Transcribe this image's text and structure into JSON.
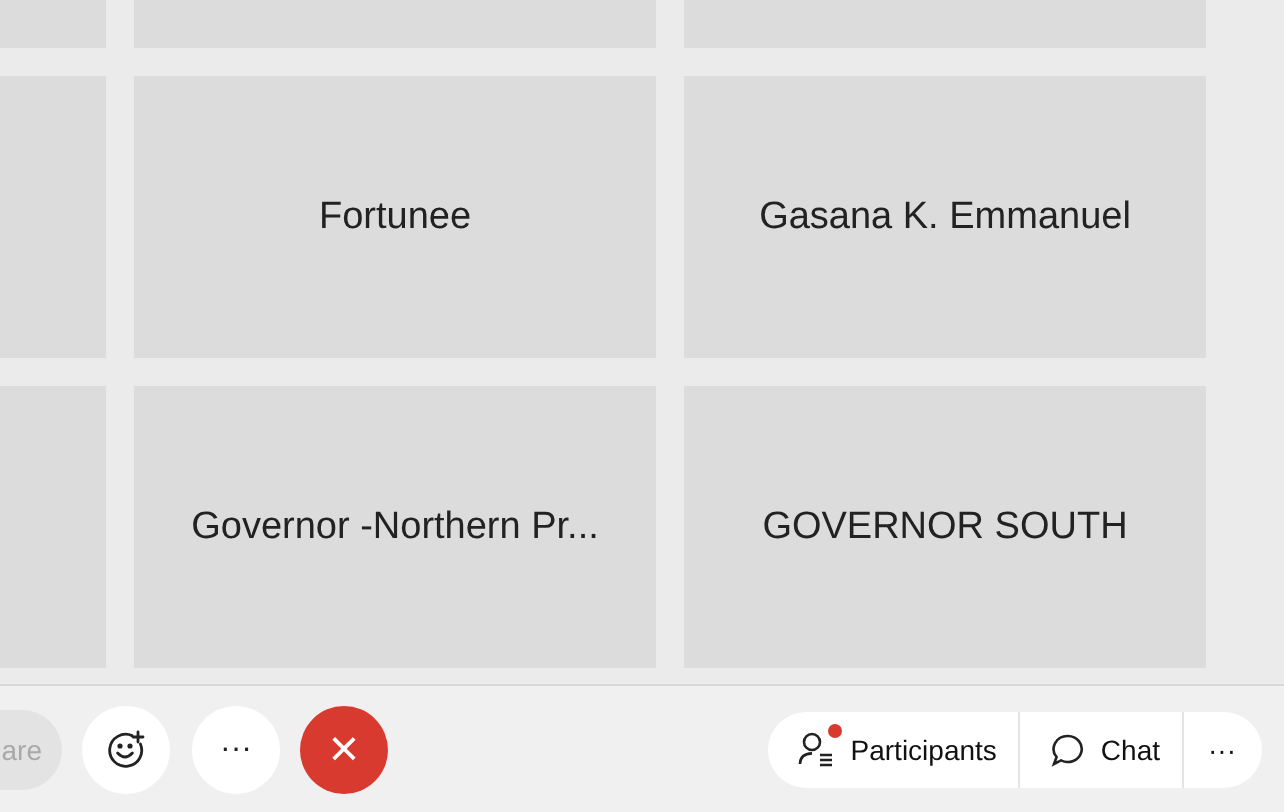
{
  "tiles": [
    {
      "kind": "blank"
    },
    {
      "kind": "blank"
    },
    {
      "kind": "blank"
    },
    {
      "kind": "blank"
    },
    {
      "kind": "named",
      "name": "Fortunee"
    },
    {
      "kind": "named",
      "name": "Gasana K. Emmanuel"
    },
    {
      "kind": "blank"
    },
    {
      "kind": "named",
      "name": "Governor -Northern Pr..."
    },
    {
      "kind": "named",
      "name": "GOVERNOR SOUTH"
    }
  ],
  "toolbar": {
    "share": {
      "label": "are",
      "disabled": true
    },
    "end_call": {
      "label": "×"
    }
  },
  "panel_buttons": {
    "participants": {
      "label": "Participants",
      "notification": true
    },
    "chat": {
      "label": "Chat"
    },
    "more": {
      "label": "···"
    }
  },
  "more_button": {
    "label": "···"
  }
}
